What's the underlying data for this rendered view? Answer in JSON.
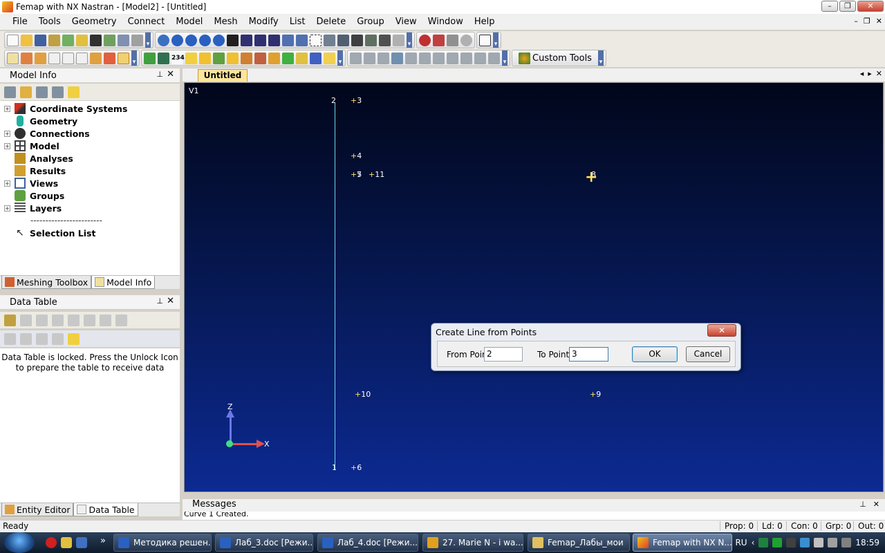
{
  "window": {
    "title": "Femap with NX Nastran - [Model2] - [Untitled]",
    "minimize": "–",
    "maximize": "❐",
    "close": "✕"
  },
  "menu": [
    "File",
    "Tools",
    "Geometry",
    "Connect",
    "Model",
    "Mesh",
    "Modify",
    "List",
    "Delete",
    "Group",
    "View",
    "Window",
    "Help"
  ],
  "mdi_controls": [
    "–",
    "❐",
    "✕"
  ],
  "toolbar": {
    "custom_tools_label": "Custom Tools",
    "counter_badge": "234"
  },
  "model_info": {
    "header": "Model Info",
    "pin": "⊥",
    "close": "✕",
    "tree": [
      {
        "label": "Coordinate Systems",
        "expandable": true,
        "icon": "coordinate-systems-icon",
        "color": "#d03020"
      },
      {
        "label": "Geometry",
        "expandable": false,
        "icon": "geometry-icon",
        "color": "#20b0a0"
      },
      {
        "label": "Connections",
        "expandable": true,
        "icon": "connections-icon",
        "color": "#303030"
      },
      {
        "label": "Model",
        "expandable": true,
        "icon": "model-icon",
        "color": "#404040"
      },
      {
        "label": "Analyses",
        "expandable": false,
        "icon": "analyses-icon",
        "color": "#c09020"
      },
      {
        "label": "Results",
        "expandable": false,
        "icon": "results-icon",
        "color": "#d0a030"
      },
      {
        "label": "Views",
        "expandable": true,
        "icon": "views-icon",
        "color": "#4060a0"
      },
      {
        "label": "Groups",
        "expandable": false,
        "icon": "groups-icon",
        "color": "#60a040"
      },
      {
        "label": "Layers",
        "expandable": true,
        "icon": "layers-icon",
        "color": "#505050"
      }
    ],
    "separator": "------------------------",
    "selection_list": "Selection List"
  },
  "left_tabs_top": [
    {
      "label": "Meshing Toolbox",
      "active": false
    },
    {
      "label": "Model Info",
      "active": true
    }
  ],
  "data_table": {
    "header": "Data Table",
    "pin": "⊥",
    "close": "✕",
    "message": "Data Table is locked. Press the Unlock Icon to prepare the table to receive data"
  },
  "left_tabs_bottom": [
    {
      "label": "Entity Editor",
      "active": false
    },
    {
      "label": "Data Table",
      "active": true
    }
  ],
  "document": {
    "tab": "Untitled",
    "controls": [
      "◂",
      "▸",
      "✕"
    ]
  },
  "viewport": {
    "view_label": "V1",
    "points": [
      "2",
      "3",
      "4",
      "5",
      "7",
      "11",
      "8",
      "10",
      "9",
      "1",
      "6"
    ],
    "axis_x": "X",
    "axis_z": "Z"
  },
  "dialog": {
    "title": "Create Line from Points",
    "close": "✕",
    "from_label": "From Point",
    "from_value": "2",
    "to_label": "To Point",
    "to_value": "3",
    "ok": "OK",
    "cancel": "Cancel"
  },
  "messages": {
    "header": "Messages",
    "pin": "⊥",
    "close": "✕",
    "last": "Curve 1 Created."
  },
  "status": {
    "ready": "Ready",
    "prop": "Prop: 0",
    "ld": "Ld: 0",
    "con": "Con: 0",
    "grp": "Grp: 0",
    "out": "Out: 0"
  },
  "taskbar": {
    "more": "»",
    "tasks": [
      {
        "label": "Методика решен...",
        "active": false,
        "color": "#2a60c0"
      },
      {
        "label": "Лаб_3.doc [Режи...",
        "active": false,
        "color": "#2a60c0"
      },
      {
        "label": "Лаб_4.doc [Режи...",
        "active": false,
        "color": "#2a60c0"
      },
      {
        "label": "27. Marie N - i wa...",
        "active": false,
        "color": "#e0a020"
      },
      {
        "label": "Femap_Лабы_мои",
        "active": false,
        "color": "#e0c060"
      },
      {
        "label": "Femap with NX N...",
        "active": true,
        "color": "#e06020"
      }
    ],
    "lang": "RU",
    "tray_arrow": "‹",
    "clock": "18:59"
  }
}
